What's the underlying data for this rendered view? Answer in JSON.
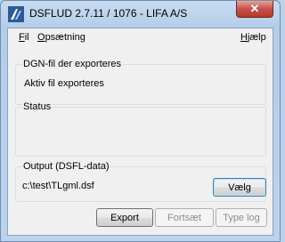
{
  "window": {
    "title": "DSFLUD 2.7.11 / 1076 - LIFA A/S",
    "close_glyph": "✕"
  },
  "menu": {
    "file": {
      "mnemonic": "F",
      "rest": "il"
    },
    "settings": {
      "mnemonic": "O",
      "rest": "psætning"
    },
    "help": {
      "mnemonic": "H",
      "rest": "jælp"
    }
  },
  "dgn_group": {
    "label": "DGN-fil der exporteres",
    "value": "Aktiv fil exporteres"
  },
  "status_group": {
    "label": "Status",
    "value": ""
  },
  "output_group": {
    "label": "Output (DSFL-data)",
    "path": "c:\\test\\TLgml.dsf",
    "choose_button": "Vælg"
  },
  "buttons": {
    "export": "Export",
    "continue": "Fortsæt",
    "log": "Type log"
  },
  "colors": {
    "titlebar_bg": "#c8dcf0",
    "close_red": "#c75050",
    "client_bg": "#f0f0f0"
  },
  "icons": {
    "app": "lifa-app-icon",
    "close": "close-icon"
  }
}
